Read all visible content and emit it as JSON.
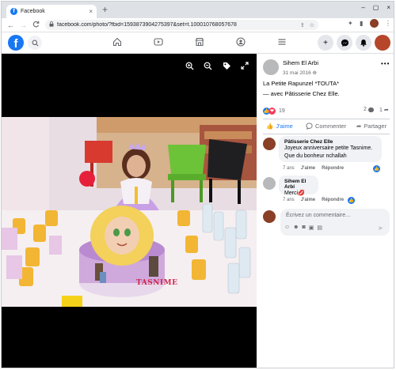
{
  "browser": {
    "tab_title": "Facebook",
    "tab_close": "×",
    "new_tab": "+",
    "back": "←",
    "forward": "→",
    "reload": "C",
    "url": "facebook.com/photo/?fbid=1593873904275397&set=t.100010768057678",
    "win_minimize": "–",
    "win_restore": "▢",
    "win_close": "×"
  },
  "photo": {
    "caption_on_cake": "TASNIME"
  },
  "post": {
    "author": "Sihem El Arbi",
    "date": "31 mai 2016",
    "caption_line1": "La Petite Rapunzel *TOUTA*",
    "caption_line2": "— avec Pâtisserie Chez Elle.",
    "reaction_count": "19",
    "comment_count": "2",
    "share_count": "1"
  },
  "actions": {
    "like": "J'aime",
    "comment": "Commenter",
    "share": "Partager"
  },
  "comments": [
    {
      "author": "Pâtisserie Chez Elle",
      "text_line1": "Joyeux anniversaire petite Tasnime.",
      "text_line2": "Que du bonheur nchallah",
      "time": "7 ans",
      "like": "J'aime",
      "reply": "Répondre"
    },
    {
      "author": "Sihem El Arbi",
      "text": "Merci💋",
      "time": "7 ans",
      "like": "J'aime",
      "reply": "Répondre"
    }
  ],
  "composer": {
    "placeholder": "Écrivez un commentaire…"
  },
  "colors": {
    "brand": "#1877f2",
    "heart": "#f33e58",
    "panel_bg": "#ffffff",
    "bubble_bg": "#f0f2f5"
  },
  "icons": [
    "facebook-logo",
    "search-icon",
    "home-icon",
    "video-icon",
    "marketplace-icon",
    "groups-icon",
    "menu-icon",
    "plus-icon",
    "messenger-icon",
    "bell-icon",
    "zoom-in-icon",
    "zoom-out-icon",
    "tag-icon",
    "fullscreen-icon"
  ]
}
